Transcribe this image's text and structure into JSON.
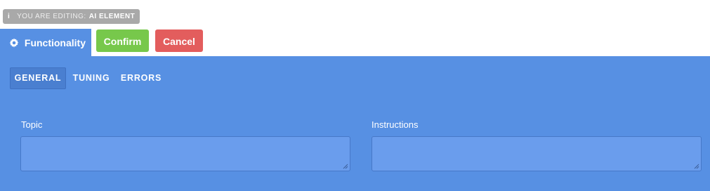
{
  "editing_badge": {
    "icon": "info-icon",
    "prefix": "YOU ARE EDITING:",
    "target": "AI ELEMENT"
  },
  "top_tab": {
    "icon": "gear-icon",
    "label": "Functionality"
  },
  "actions": {
    "confirm_label": "Confirm",
    "cancel_label": "Cancel"
  },
  "subtabs": [
    {
      "label": "GENERAL",
      "active": true
    },
    {
      "label": "TUNING",
      "active": false
    },
    {
      "label": "ERRORS",
      "active": false
    }
  ],
  "fields": {
    "topic": {
      "label": "Topic",
      "value": ""
    },
    "instructions": {
      "label": "Instructions",
      "value": ""
    }
  },
  "colors": {
    "panel": "#5790e3",
    "confirm": "#77c84b",
    "cancel": "#e35d5d",
    "badge": "#a9a9a9"
  }
}
